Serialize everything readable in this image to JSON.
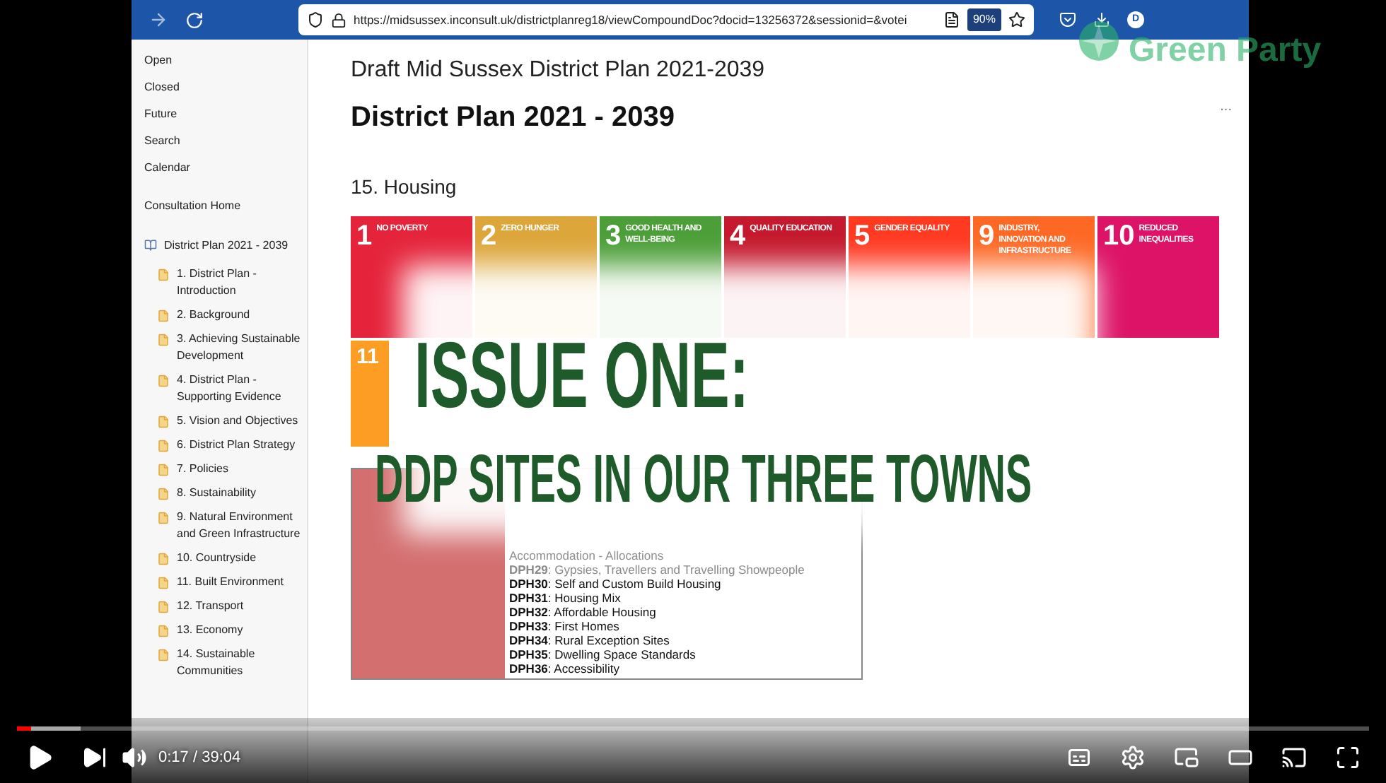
{
  "browser": {
    "url": "https://midsussex.inconsult.uk/districtplanreg18/viewCompoundDoc?docid=13256372&sessionid=&votei",
    "zoom": "90%",
    "profile": "D"
  },
  "sidebar": {
    "nav": [
      "Open",
      "Closed",
      "Future",
      "Search",
      "Calendar"
    ],
    "home": "Consultation Home",
    "tree": {
      "label": "District Plan 2021 - 2039",
      "children": [
        {
          "label": "1. District Plan - Introduction"
        },
        {
          "label": "2. Background"
        },
        {
          "label": "3. Achieving Sustainable Development"
        },
        {
          "label": "4. District Plan - Supporting Evidence"
        },
        {
          "label": "5. Vision and Objectives"
        },
        {
          "label": "6. District Plan Strategy"
        },
        {
          "label": "7. Policies"
        },
        {
          "label": "8. Sustainability"
        },
        {
          "label": "9. Natural Environment and Green Infrastructure"
        },
        {
          "label": "10. Countryside"
        },
        {
          "label": "11. Built Environment"
        },
        {
          "label": "12. Transport"
        },
        {
          "label": "13. Economy"
        },
        {
          "label": "14. Sustainable Communities"
        }
      ]
    }
  },
  "page": {
    "heading": "Draft Mid Sussex District Plan 2021-2039",
    "title": "District Plan 2021 - 2039",
    "more": "...",
    "section": "15. Housing",
    "goals": [
      {
        "number": "1",
        "label": "NO POVERTY",
        "color": "#e5243b"
      },
      {
        "number": "2",
        "label": "ZERO HUNGER",
        "color": "#dda63a"
      },
      {
        "number": "3",
        "label": "GOOD HEALTH AND WELL-BEING",
        "color": "#4c9f38"
      },
      {
        "number": "4",
        "label": "QUALITY EDUCATION",
        "color": "#c5192d"
      },
      {
        "number": "5",
        "label": "GENDER EQUALITY",
        "color": "#ff3a21"
      },
      {
        "number": "9",
        "label": "INDUSTRY, INNOVATION AND INFRASTRUCTURE",
        "color": "#fd6925"
      },
      {
        "number": "10",
        "label": "REDUCED INEQUALITIES",
        "color": "#dd1367"
      },
      {
        "number": "11",
        "color": "#fd9d24"
      }
    ],
    "policies": [
      {
        "text": "Accommodation - Allocations",
        "faded": true
      },
      {
        "text": "**DPH29**: Gypsies, Travellers and Travelling Showpeople",
        "faded": true
      },
      {
        "text": "**DPH30**: Self and Custom Build Housing",
        "faded": false
      },
      {
        "text": "**DPH31**: Housing Mix",
        "faded": false
      },
      {
        "text": "**DPH32**: Affordable Housing",
        "faded": false
      },
      {
        "text": "**DPH33**: First Homes",
        "faded": false
      },
      {
        "text": "**DPH34**: Rural Exception Sites",
        "faded": false
      },
      {
        "text": "**DPH35**: Dwelling Space Standards",
        "faded": false
      },
      {
        "text": "**DPH36**: Accessibility",
        "faded": false
      }
    ]
  },
  "overlay": {
    "lines": [
      "ISSUE ONE:",
      "DDP SITES IN OUR THREE TOWNS"
    ],
    "brand": "Green Party"
  },
  "player": {
    "time": "0:17 / 39:04",
    "level": 0.01
  }
}
